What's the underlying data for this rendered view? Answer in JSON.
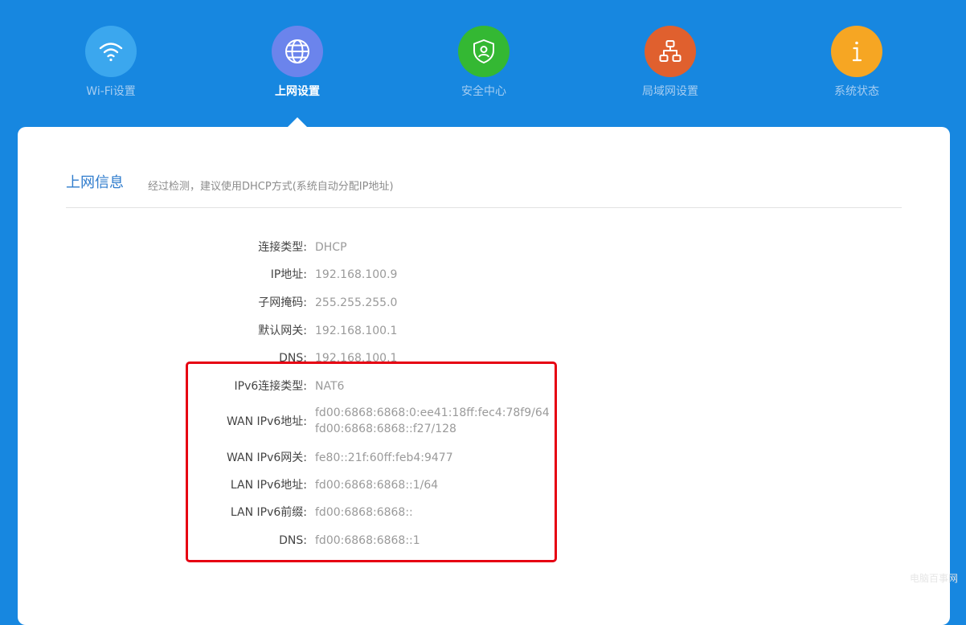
{
  "nav": {
    "items": [
      {
        "label": "Wi-Fi设置",
        "icon": "wifi-icon",
        "color": "#3ba7ee"
      },
      {
        "label": "上网设置",
        "icon": "globe-icon",
        "color": "#6b84ec",
        "active": true
      },
      {
        "label": "安全中心",
        "icon": "shield-icon",
        "color": "#34b833"
      },
      {
        "label": "局域网设置",
        "icon": "network-icon",
        "color": "#e0602e"
      },
      {
        "label": "系统状态",
        "icon": "info-icon",
        "color": "#f6a623"
      }
    ]
  },
  "section": {
    "title": "上网信息",
    "hint": "经过检测，建议使用DHCP方式(系统自动分配IP地址)"
  },
  "info": {
    "connection_type": {
      "label": "连接类型:",
      "value": "DHCP"
    },
    "ip_address": {
      "label": "IP地址:",
      "value": "192.168.100.9"
    },
    "subnet_mask": {
      "label": "子网掩码:",
      "value": "255.255.255.0"
    },
    "gateway": {
      "label": "默认网关:",
      "value": "192.168.100.1"
    },
    "dns": {
      "label": "DNS:",
      "value": "192.168.100.1"
    },
    "ipv6_type": {
      "label": "IPv6连接类型:",
      "value": "NAT6"
    },
    "wan_ipv6_address": {
      "label": "WAN IPv6地址:",
      "value_1": "fd00:6868:6868:0:ee41:18ff:fec4:78f9/64",
      "value_2": "fd00:6868:6868::f27/128"
    },
    "wan_ipv6_gateway": {
      "label": "WAN IPv6网关:",
      "value": "fe80::21f:60ff:feb4:9477"
    },
    "lan_ipv6_address": {
      "label": "LAN IPv6地址:",
      "value": "fd00:6868:6868::1/64"
    },
    "lan_ipv6_prefix": {
      "label": "LAN IPv6前缀:",
      "value": "fd00:6868:6868::"
    },
    "ipv6_dns": {
      "label": "DNS:",
      "value": "fd00:6868:6868::1"
    }
  },
  "colors": {
    "background": "#1787e0",
    "title_blue": "#2f7ccd",
    "highlight_red": "#e60012"
  },
  "watermark": "电脑百事网"
}
